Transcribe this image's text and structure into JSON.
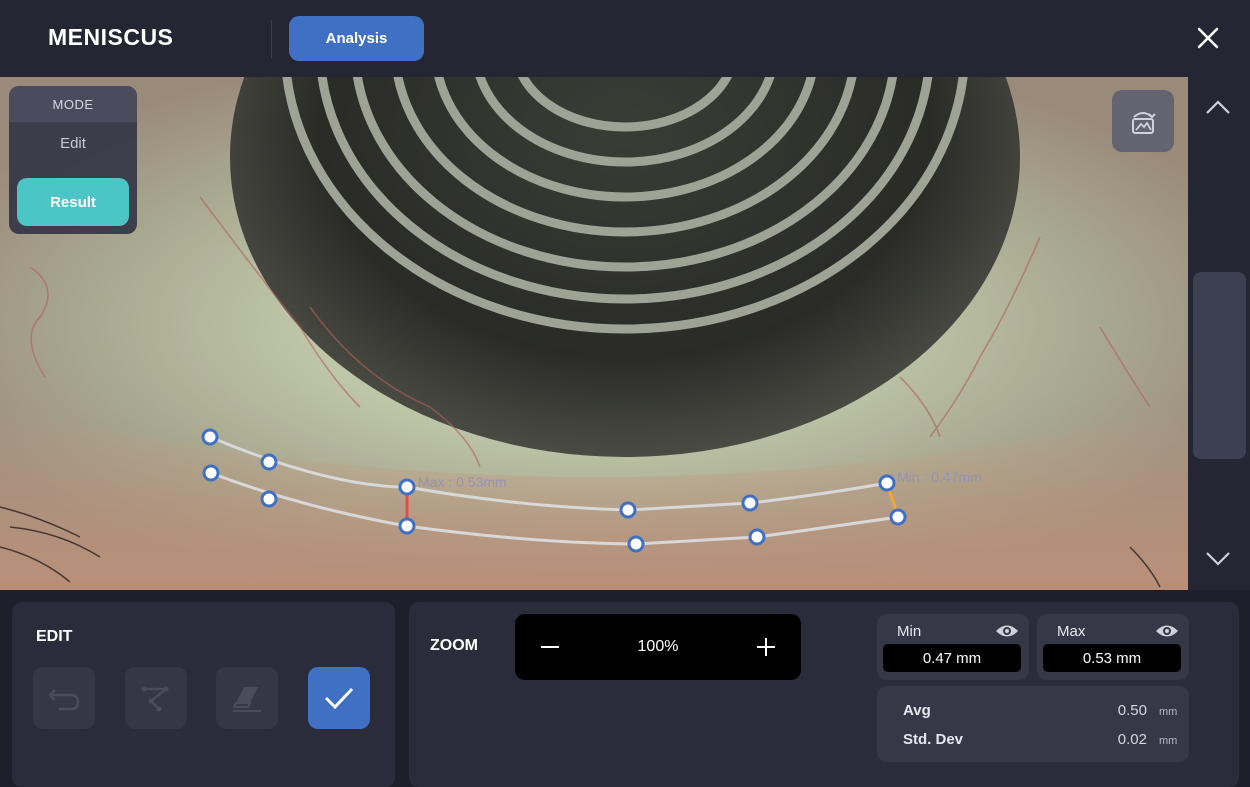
{
  "header": {
    "app_title": "MENISCUS",
    "analysis_label": "Analysis",
    "close_icon": "close-icon"
  },
  "mode": {
    "header": "MODE",
    "edit_label": "Edit",
    "result_label": "Result",
    "selected": "Result"
  },
  "image": {
    "max_label": "Max : 0.53mm",
    "min_label": "Min : 0.47mm",
    "photo_icon": "photo-rotate-icon"
  },
  "edit": {
    "title": "EDIT",
    "tools": [
      "undo-icon",
      "draw-line-icon",
      "eraser-icon",
      "check-icon"
    ]
  },
  "zoom": {
    "label": "ZOOM",
    "value": "100%"
  },
  "stats": {
    "min": {
      "label": "Min",
      "value": "0.47 mm"
    },
    "max": {
      "label": "Max",
      "value": "0.53 mm"
    },
    "avg": {
      "label": "Avg",
      "value": "0.50",
      "unit": "mm"
    },
    "std": {
      "label": "Std. Dev",
      "value": "0.02",
      "unit": "mm"
    }
  },
  "colors": {
    "accent_blue": "#3f70c4",
    "result_teal": "#4cc5c6",
    "max_marker": "#e84a4a",
    "min_marker": "#f0a830"
  }
}
